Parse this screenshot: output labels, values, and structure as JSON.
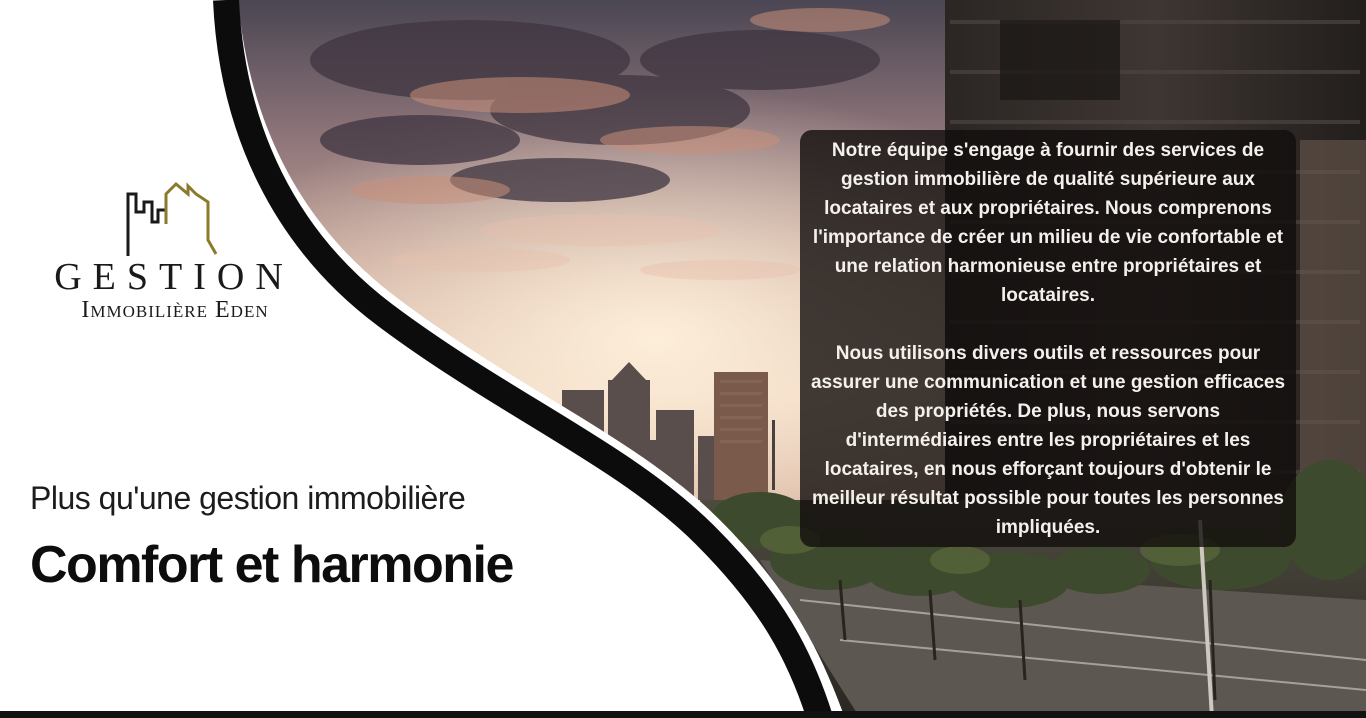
{
  "brand": {
    "name_line1": "GESTION",
    "name_line2": "Immobilière Eden",
    "logo_icon": "city-skyline-icon",
    "accent_color": "#8a7a2b",
    "text_color": "#1a1a1a"
  },
  "hero": {
    "subtitle": "Plus qu'une gestion immobilière",
    "headline": "Comfort et harmonie"
  },
  "info": {
    "paragraph_1": "Notre équipe s'engage à fournir des services de gestion immobilière de qualité supérieure aux locataires et aux propriétaires. Nous comprenons l'importance de créer un milieu de vie confortable et une relation harmonieuse entre propriétaires et locataires.",
    "paragraph_2": "Nous utilisons divers outils et ressources pour assurer une communication et une gestion efficaces des propriétés. De plus, nous servons d'intermédiaires entre les propriétaires et les locataires, en nous efforçant toujours d'obtenir le meilleur résultat possible pour toutes les personnes impliquées."
  }
}
